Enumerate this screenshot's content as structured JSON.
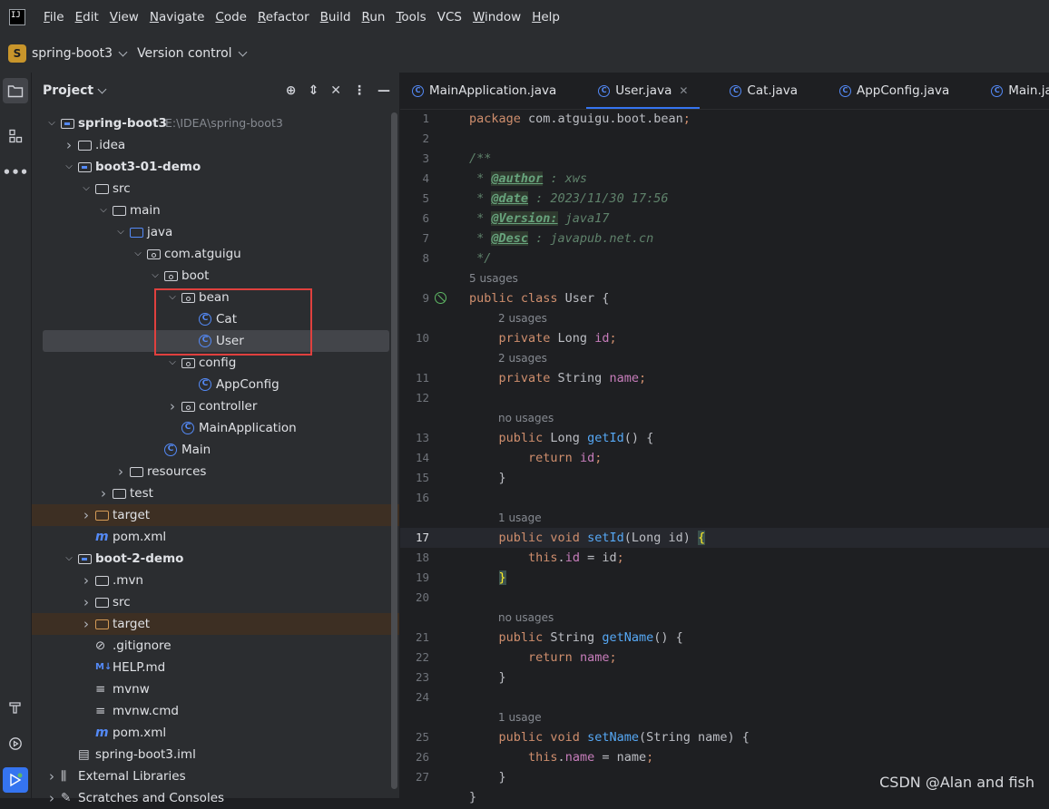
{
  "menu": [
    "File",
    "Edit",
    "View",
    "Navigate",
    "Code",
    "Refactor",
    "Build",
    "Run",
    "Tools",
    "VCS",
    "Window",
    "Help"
  ],
  "toolbar": {
    "project_badge": "S",
    "project_name": "spring-boot3",
    "vcs_label": "Version control"
  },
  "panel": {
    "title": "Project"
  },
  "tree": [
    {
      "label": "spring-boot3",
      "extra": "E:\\IDEA\\spring-boot3",
      "depth": 0,
      "arrow": "open",
      "icon": "module-folder",
      "bold": true
    },
    {
      "label": ".idea",
      "depth": 1,
      "arrow": "closed",
      "icon": "folder"
    },
    {
      "label": "boot3-01-demo",
      "depth": 1,
      "arrow": "open",
      "icon": "module-folder",
      "bold": true
    },
    {
      "label": "src",
      "depth": 2,
      "arrow": "open",
      "icon": "folder"
    },
    {
      "label": "main",
      "depth": 3,
      "arrow": "open",
      "icon": "folder"
    },
    {
      "label": "java",
      "depth": 4,
      "arrow": "open",
      "icon": "source-folder"
    },
    {
      "label": "com.atguigu",
      "depth": 5,
      "arrow": "open",
      "icon": "package"
    },
    {
      "label": "boot",
      "depth": 6,
      "arrow": "open",
      "icon": "package"
    },
    {
      "label": "bean",
      "depth": 7,
      "arrow": "open",
      "icon": "package"
    },
    {
      "label": "Cat",
      "depth": 8,
      "arrow": "none",
      "icon": "class"
    },
    {
      "label": "User",
      "depth": 8,
      "arrow": "none",
      "icon": "class",
      "selected": true
    },
    {
      "label": "config",
      "depth": 7,
      "arrow": "open",
      "icon": "package"
    },
    {
      "label": "AppConfig",
      "depth": 8,
      "arrow": "none",
      "icon": "class"
    },
    {
      "label": "controller",
      "depth": 7,
      "arrow": "closed",
      "icon": "package"
    },
    {
      "label": "MainApplication",
      "depth": 7,
      "arrow": "none",
      "icon": "class"
    },
    {
      "label": "Main",
      "depth": 6,
      "arrow": "none",
      "icon": "class"
    },
    {
      "label": "resources",
      "depth": 4,
      "arrow": "closed",
      "icon": "resources-folder"
    },
    {
      "label": "test",
      "depth": 3,
      "arrow": "closed",
      "icon": "folder"
    },
    {
      "label": "target",
      "depth": 2,
      "arrow": "closed",
      "icon": "excluded-folder",
      "excluded": true
    },
    {
      "label": "pom.xml",
      "depth": 2,
      "arrow": "none",
      "icon": "maven"
    },
    {
      "label": "boot-2-demo",
      "depth": 1,
      "arrow": "open",
      "icon": "module-folder",
      "bold": true
    },
    {
      "label": ".mvn",
      "depth": 2,
      "arrow": "closed",
      "icon": "folder"
    },
    {
      "label": "src",
      "depth": 2,
      "arrow": "closed",
      "icon": "folder"
    },
    {
      "label": "target",
      "depth": 2,
      "arrow": "closed",
      "icon": "excluded-folder",
      "excluded": true
    },
    {
      "label": ".gitignore",
      "depth": 2,
      "arrow": "none",
      "icon": "ignore"
    },
    {
      "label": "HELP.md",
      "depth": 2,
      "arrow": "none",
      "icon": "markdown"
    },
    {
      "label": "mvnw",
      "depth": 2,
      "arrow": "none",
      "icon": "text-file"
    },
    {
      "label": "mvnw.cmd",
      "depth": 2,
      "arrow": "none",
      "icon": "text-file"
    },
    {
      "label": "pom.xml",
      "depth": 2,
      "arrow": "none",
      "icon": "maven"
    },
    {
      "label": "spring-boot3.iml",
      "depth": 1,
      "arrow": "none",
      "icon": "iml-file"
    },
    {
      "label": "External Libraries",
      "depth": 0,
      "arrow": "closed",
      "icon": "libraries"
    },
    {
      "label": "Scratches and Consoles",
      "depth": 0,
      "arrow": "closed",
      "icon": "scratches"
    }
  ],
  "tabs": [
    {
      "label": "MainApplication.java"
    },
    {
      "label": "User.java",
      "active": true
    },
    {
      "label": "Cat.java"
    },
    {
      "label": "AppConfig.java"
    },
    {
      "label": "Main.java"
    }
  ],
  "code": [
    {
      "ln": "1",
      "kind": "code",
      "tokens": [
        [
          "kw",
          "package "
        ],
        [
          "plain",
          "com.atguigu.boot.bean"
        ],
        [
          "kw",
          ";"
        ]
      ]
    },
    {
      "ln": "2",
      "kind": "code",
      "tokens": []
    },
    {
      "ln": "3",
      "kind": "code",
      "tokens": [
        [
          "cm",
          "/**"
        ]
      ]
    },
    {
      "ln": "4",
      "kind": "code",
      "tokens": [
        [
          "cm",
          " * "
        ],
        [
          "tag",
          "@author"
        ],
        [
          "cm",
          " : xws"
        ]
      ]
    },
    {
      "ln": "5",
      "kind": "code",
      "tokens": [
        [
          "cm",
          " * "
        ],
        [
          "tag",
          "@date"
        ],
        [
          "cm",
          " : 2023/11/30 17:56"
        ]
      ]
    },
    {
      "ln": "6",
      "kind": "code",
      "tokens": [
        [
          "cm",
          " * "
        ],
        [
          "tag",
          "@Version:"
        ],
        [
          "cm",
          " java17"
        ]
      ]
    },
    {
      "ln": "7",
      "kind": "code",
      "tokens": [
        [
          "cm",
          " * "
        ],
        [
          "tag",
          "@Desc"
        ],
        [
          "cm",
          " : javapub.net.cn"
        ]
      ]
    },
    {
      "ln": "8",
      "kind": "code",
      "tokens": [
        [
          "cm",
          " */"
        ]
      ]
    },
    {
      "ln": "",
      "kind": "hint",
      "text": "5 usages",
      "indent": 0
    },
    {
      "ln": "9",
      "kind": "code",
      "gutter": true,
      "tokens": [
        [
          "kw",
          "public class "
        ],
        [
          "plain",
          "User {"
        ]
      ]
    },
    {
      "ln": "",
      "kind": "hint",
      "text": "2 usages",
      "indent": 1
    },
    {
      "ln": "10",
      "kind": "code",
      "tokens": [
        [
          "plain",
          "    "
        ],
        [
          "kw",
          "private "
        ],
        [
          "plain",
          "Long "
        ],
        [
          "fld",
          "id"
        ],
        [
          "kw",
          ";"
        ]
      ]
    },
    {
      "ln": "",
      "kind": "hint",
      "text": "2 usages",
      "indent": 1
    },
    {
      "ln": "11",
      "kind": "code",
      "tokens": [
        [
          "plain",
          "    "
        ],
        [
          "kw",
          "private "
        ],
        [
          "plain",
          "String "
        ],
        [
          "fld",
          "name"
        ],
        [
          "kw",
          ";"
        ]
      ]
    },
    {
      "ln": "12",
      "kind": "code",
      "tokens": []
    },
    {
      "ln": "",
      "kind": "hint",
      "text": "no usages",
      "indent": 1
    },
    {
      "ln": "13",
      "kind": "code",
      "tokens": [
        [
          "plain",
          "    "
        ],
        [
          "kw",
          "public "
        ],
        [
          "plain",
          "Long "
        ],
        [
          "fn",
          "getId"
        ],
        [
          "plain",
          "() {"
        ]
      ]
    },
    {
      "ln": "14",
      "kind": "code",
      "tokens": [
        [
          "plain",
          "        "
        ],
        [
          "kw",
          "return "
        ],
        [
          "fld",
          "id"
        ],
        [
          "kw",
          ";"
        ]
      ]
    },
    {
      "ln": "15",
      "kind": "code",
      "tokens": [
        [
          "plain",
          "    }"
        ]
      ]
    },
    {
      "ln": "16",
      "kind": "code",
      "tokens": []
    },
    {
      "ln": "",
      "kind": "hint",
      "text": "1 usage",
      "indent": 1
    },
    {
      "ln": "17",
      "kind": "code",
      "current": true,
      "tokens": [
        [
          "plain",
          "    "
        ],
        [
          "kw",
          "public void "
        ],
        [
          "fn",
          "setId"
        ],
        [
          "plain",
          "(Long id) "
        ],
        [
          "brace",
          "{"
        ]
      ]
    },
    {
      "ln": "18",
      "kind": "code",
      "tokens": [
        [
          "plain",
          "        "
        ],
        [
          "kw",
          "this"
        ],
        [
          "plain",
          "."
        ],
        [
          "fld",
          "id"
        ],
        [
          "plain",
          " = id"
        ],
        [
          "kw",
          ";"
        ]
      ]
    },
    {
      "ln": "19",
      "kind": "code",
      "tokens": [
        [
          "plain",
          "    "
        ],
        [
          "brace",
          "}"
        ]
      ]
    },
    {
      "ln": "20",
      "kind": "code",
      "tokens": []
    },
    {
      "ln": "",
      "kind": "hint",
      "text": "no usages",
      "indent": 1
    },
    {
      "ln": "21",
      "kind": "code",
      "tokens": [
        [
          "plain",
          "    "
        ],
        [
          "kw",
          "public "
        ],
        [
          "plain",
          "String "
        ],
        [
          "fn",
          "getName"
        ],
        [
          "plain",
          "() {"
        ]
      ]
    },
    {
      "ln": "22",
      "kind": "code",
      "tokens": [
        [
          "plain",
          "        "
        ],
        [
          "kw",
          "return "
        ],
        [
          "fld",
          "name"
        ],
        [
          "kw",
          ";"
        ]
      ]
    },
    {
      "ln": "23",
      "kind": "code",
      "tokens": [
        [
          "plain",
          "    }"
        ]
      ]
    },
    {
      "ln": "24",
      "kind": "code",
      "tokens": []
    },
    {
      "ln": "",
      "kind": "hint",
      "text": "1 usage",
      "indent": 1
    },
    {
      "ln": "25",
      "kind": "code",
      "tokens": [
        [
          "plain",
          "    "
        ],
        [
          "kw",
          "public void "
        ],
        [
          "fn",
          "setName"
        ],
        [
          "plain",
          "(String name) {"
        ]
      ]
    },
    {
      "ln": "26",
      "kind": "code",
      "tokens": [
        [
          "plain",
          "        "
        ],
        [
          "kw",
          "this"
        ],
        [
          "plain",
          "."
        ],
        [
          "fld",
          "name"
        ],
        [
          "plain",
          " = name"
        ],
        [
          "kw",
          ";"
        ]
      ]
    },
    {
      "ln": "27",
      "kind": "code",
      "tokens": [
        [
          "plain",
          "    }"
        ]
      ]
    },
    {
      "ln": "",
      "kind": "code",
      "tokens": [
        [
          "plain",
          "}"
        ]
      ]
    }
  ],
  "watermark": "CSDN @Alan and fish",
  "colors": {
    "accent": "#3574f0",
    "highlight_box": "#e0403e",
    "class_icon": "#548af7"
  }
}
